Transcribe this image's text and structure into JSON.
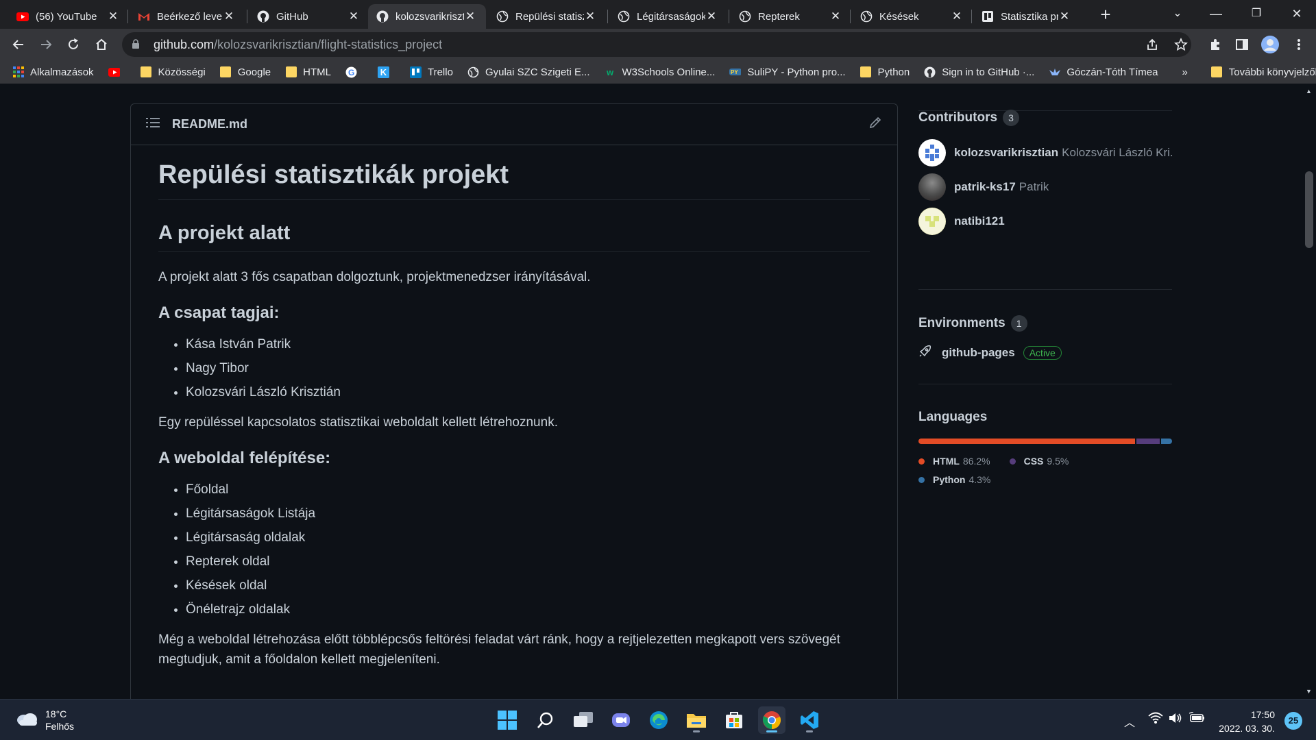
{
  "tabs": [
    {
      "title": "(56) YouTube",
      "icon": "youtube-icon"
    },
    {
      "title": "Beérkező levelek",
      "icon": "gmail-icon"
    },
    {
      "title": "GitHub",
      "icon": "github-icon"
    },
    {
      "title": "kolozsvarikrisztian",
      "icon": "github-icon",
      "active": true
    },
    {
      "title": "Repülési statisztikák",
      "icon": "globe-icon"
    },
    {
      "title": "Légitársaságok",
      "icon": "globe-icon"
    },
    {
      "title": "Repterek",
      "icon": "globe-icon"
    },
    {
      "title": "Késések",
      "icon": "globe-icon"
    },
    {
      "title": "Statisztika projekt",
      "icon": "bookmark-app-icon"
    }
  ],
  "omnibox": {
    "host": "github.com",
    "path": "/kolozsvarikrisztian/flight-statistics_project"
  },
  "bookmarks": [
    {
      "label": "Alkalmazások",
      "icon": "apps-grid-icon"
    },
    {
      "label": "",
      "icon": "youtube-icon"
    },
    {
      "label": "Közösségi",
      "icon": "folder-icon"
    },
    {
      "label": "Google",
      "icon": "folder-icon"
    },
    {
      "label": "HTML",
      "icon": "folder-icon"
    },
    {
      "label": "",
      "icon": "google-icon"
    },
    {
      "label": "",
      "icon": "k-icon"
    },
    {
      "label": "Trello",
      "icon": "trello-icon"
    },
    {
      "label": "Gyulai SZC Szigeti E...",
      "icon": "globe-icon"
    },
    {
      "label": "W3Schools Online...",
      "icon": "w3schools-icon"
    },
    {
      "label": "SuliPY - Python pro...",
      "icon": "python-icon"
    },
    {
      "label": "Python",
      "icon": "folder-icon"
    },
    {
      "label": "Sign in to GitHub ·...",
      "icon": "github-icon"
    },
    {
      "label": "Góczán-Tóth Tímea",
      "icon": "bird-icon"
    }
  ],
  "bookmarks_more": "»",
  "bookmarks_other": "További könyvjelzők",
  "readme": {
    "filename": "README.md",
    "h1": "Repülési statisztikák projekt",
    "h2": "A projekt alatt",
    "p1": "A projekt alatt 3 fős csapatban dolgoztunk, projektmenedzser irányításával.",
    "h3_team": "A csapat tagjai:",
    "team": [
      "Kása István Patrik",
      "Nagy Tibor",
      "Kolozsvári László Krisztián"
    ],
    "p2": "Egy repüléssel kapcsolatos statisztikai weboldalt kellett létrehoznunk.",
    "h3_site": "A weboldal felépítése:",
    "pages": [
      "Főoldal",
      "Légitársaságok Listája",
      "Légitársaság oldalak",
      "Repterek oldal",
      "Késések oldal",
      "Önéletrajz oldalak"
    ],
    "p3": "Még a weboldal létrehozása előtt többlépcsős feltörési feladat várt ránk, hogy a rejtjelezetten megkapott vers szövegét megtudjuk, amit a főoldalon kellett megjeleníteni."
  },
  "sidebar": {
    "contributors_title": "Contributors",
    "contributors_count": "3",
    "contributors": [
      {
        "login": "kolozsvarikrisztian",
        "name": "Kolozsvári László Kri..."
      },
      {
        "login": "patrik-ks17",
        "name": "Patrik"
      },
      {
        "login": "natibi121",
        "name": ""
      }
    ],
    "environments_title": "Environments",
    "environments_count": "1",
    "environment": {
      "name": "github-pages",
      "status": "Active"
    },
    "languages_title": "Languages",
    "languages": [
      {
        "name": "HTML",
        "percent": "86.2%",
        "value": 86.2,
        "color": "#e34c26"
      },
      {
        "name": "CSS",
        "percent": "9.5%",
        "value": 9.5,
        "color": "#563d7c"
      },
      {
        "name": "Python",
        "percent": "4.3%",
        "value": 4.3,
        "color": "#3572A5"
      }
    ]
  },
  "taskbar": {
    "weather_temp": "18°C",
    "weather_desc": "Felhős",
    "time": "17:50",
    "date": "2022. 03. 30.",
    "notifications": "25"
  }
}
